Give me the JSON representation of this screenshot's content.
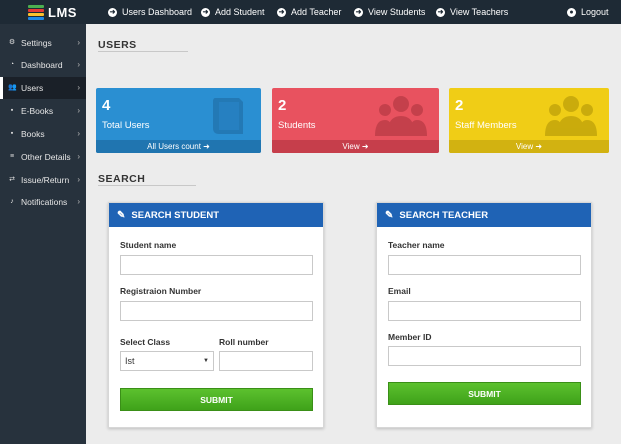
{
  "app": {
    "logo_text": "LMS"
  },
  "topnav": [
    {
      "label": "Users Dashboard"
    },
    {
      "label": "Add Student"
    },
    {
      "label": "Add Teacher"
    },
    {
      "label": "View Students"
    },
    {
      "label": "View Teachers"
    },
    {
      "label": "Logout"
    }
  ],
  "sidebar": {
    "items": [
      {
        "label": "Settings",
        "icon": "cogs-icon"
      },
      {
        "label": "Dashboard",
        "icon": "dashboard-icon"
      },
      {
        "label": "Users",
        "icon": "users-icon",
        "active": true
      },
      {
        "label": "E-Books",
        "icon": "ebook-icon"
      },
      {
        "label": "Books",
        "icon": "book-icon"
      },
      {
        "label": "Other Details",
        "icon": "list-icon"
      },
      {
        "label": "Issue/Return",
        "icon": "exchange-icon"
      },
      {
        "label": "Notifications",
        "icon": "bell-icon"
      }
    ]
  },
  "users_section": {
    "title": "USERS"
  },
  "cards": [
    {
      "count": "4",
      "label": "Total Users",
      "footer": "All Users count",
      "color": "#2a8fd2"
    },
    {
      "count": "2",
      "label": "Students",
      "footer": "View",
      "color": "#e8525f"
    },
    {
      "count": "2",
      "label": "Staff Members",
      "footer": "View",
      "color": "#f0cd16"
    }
  ],
  "search_section": {
    "title": "SEARCH"
  },
  "search_student": {
    "title": "SEARCH STUDENT",
    "student_name_label": "Student name",
    "student_name_value": "",
    "reg_number_label": "Registraion Number",
    "reg_number_value": "",
    "class_label": "Select Class",
    "class_selected": "Ist",
    "roll_label": "Roll number",
    "roll_value": "",
    "submit_label": "SUBMIT"
  },
  "search_teacher": {
    "title": "SEARCH TEACHER",
    "teacher_name_label": "Teacher name",
    "teacher_name_value": "",
    "email_label": "Email",
    "email_value": "",
    "member_id_label": "Member ID",
    "member_id_value": "",
    "submit_label": "SUBMIT"
  },
  "colors": {
    "topbar": "#1e2a35",
    "sidebar": "#27323d",
    "panel_header": "#1f63b5",
    "submit": "#4cb224"
  }
}
